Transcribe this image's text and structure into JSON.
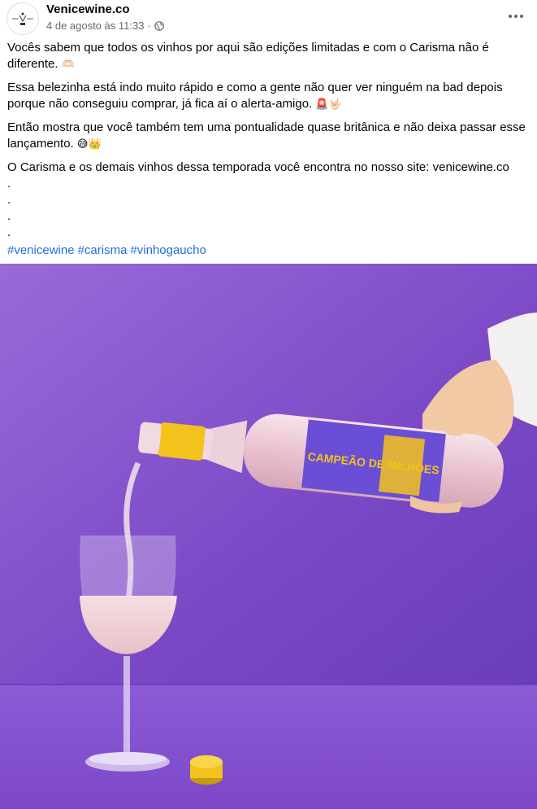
{
  "post": {
    "page_name": "Venicewine.co",
    "timestamp": "4 de agosto às 11:33",
    "separator": "·",
    "avatar_logo_text": "VENICE WINE",
    "paragraphs": [
      {
        "text": "Vocês sabem que todos os vinhos por aqui são edições limitadas e com o Carisma não é diferente.",
        "emoji": "🫶🏻"
      },
      {
        "text": "Essa belezinha está indo muito rápido e como a gente não quer ver ninguém na bad depois porque não conseguiu comprar, já fica aí o alerta-amigo.",
        "emoji": "🚨🤟🏻"
      },
      {
        "text": "Então mostra que você também tem uma pontualidade quase britânica e não deixa passar esse lançamento.",
        "emoji": "😅👑"
      },
      {
        "text": "O Carisma e os demais vinhos dessa temporada você encontra no nosso site: venicewine.co",
        "emoji": ""
      }
    ],
    "dots": [
      ".",
      ".",
      ".",
      "."
    ],
    "hashtags": [
      "#venicewine",
      "#carisma",
      "#vinhogaucho"
    ]
  },
  "photo": {
    "label_text": "CAMPEÃO DE MILHÕES",
    "colors": {
      "background": "#7e4fc8",
      "table": "#8a55d2",
      "cap": "#f3c21c",
      "label": "#6a4fd6",
      "wine": "#f2d6d9"
    }
  },
  "icons": {
    "globe": "globe-icon",
    "more": "more-options-icon"
  }
}
